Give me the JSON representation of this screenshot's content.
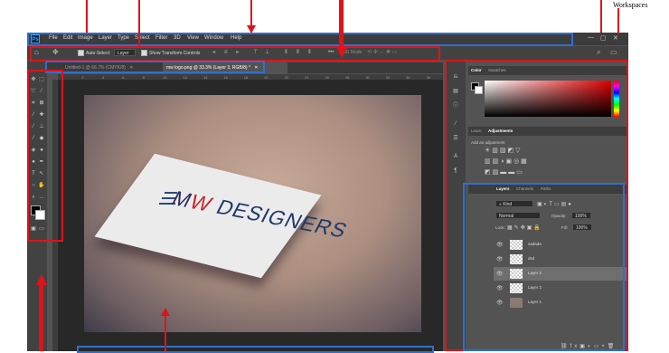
{
  "annotation": {
    "workspaces_label": "Workspaces"
  },
  "app": {
    "logo": "Ps",
    "menu": [
      "File",
      "Edit",
      "Image",
      "Layer",
      "Type",
      "Select",
      "Filter",
      "3D",
      "View",
      "Window",
      "Help"
    ],
    "window_controls": [
      "—",
      "▢",
      "✕"
    ]
  },
  "options": {
    "auto_select": "Auto-Select:",
    "auto_select_target": "Layer",
    "show_transform": "Show Transform Controls",
    "mode_3d": "3D Mode:"
  },
  "tabs": [
    {
      "label": "Untitled-1 @ 66.7% (CMYK/8)",
      "close": "✕"
    },
    {
      "label": "mw logo.png @ 33.3% (Layer 3, RGB/8) *",
      "close": "✕"
    }
  ],
  "ruler_ticks": [
    "0",
    "2",
    "4",
    "6",
    "8",
    "10",
    "12",
    "14",
    "16",
    "18",
    "20",
    "22",
    "24",
    "26",
    "28",
    "30",
    "32",
    "34",
    "36"
  ],
  "canvas": {
    "logo_text_main": "MW DESIGNERS",
    "logo_m": "M",
    "logo_w": "W",
    "logo_rest": " DESIGNERS"
  },
  "color_panel": {
    "tabs": [
      "Color",
      "Swatches"
    ]
  },
  "adjust_panel": {
    "tabs": [
      "Learn",
      "Adjustments"
    ],
    "hint": "Add an adjustment"
  },
  "layers_panel": {
    "tabs": [
      "Layers",
      "Channels",
      "Paths"
    ],
    "filter_kind": "Kind",
    "blend_mode": "Normal",
    "opacity_label": "Opacity:",
    "opacity_value": "100%",
    "lock_label": "Lock:",
    "fill_label": "Fill:",
    "fill_value": "100%",
    "layers": [
      {
        "name": "sadada",
        "selected": false
      },
      {
        "name": "dsd",
        "selected": false
      },
      {
        "name": "Layer 3",
        "selected": true
      },
      {
        "name": "Layer 2",
        "selected": false
      },
      {
        "name": "Layer 1",
        "selected": false
      }
    ]
  },
  "colors": {
    "annotation_red": "#e0121a",
    "annotation_blue": "#2f6fce",
    "ps_blue": "#31a8ff",
    "ui_dark": "#3c3c3c"
  }
}
